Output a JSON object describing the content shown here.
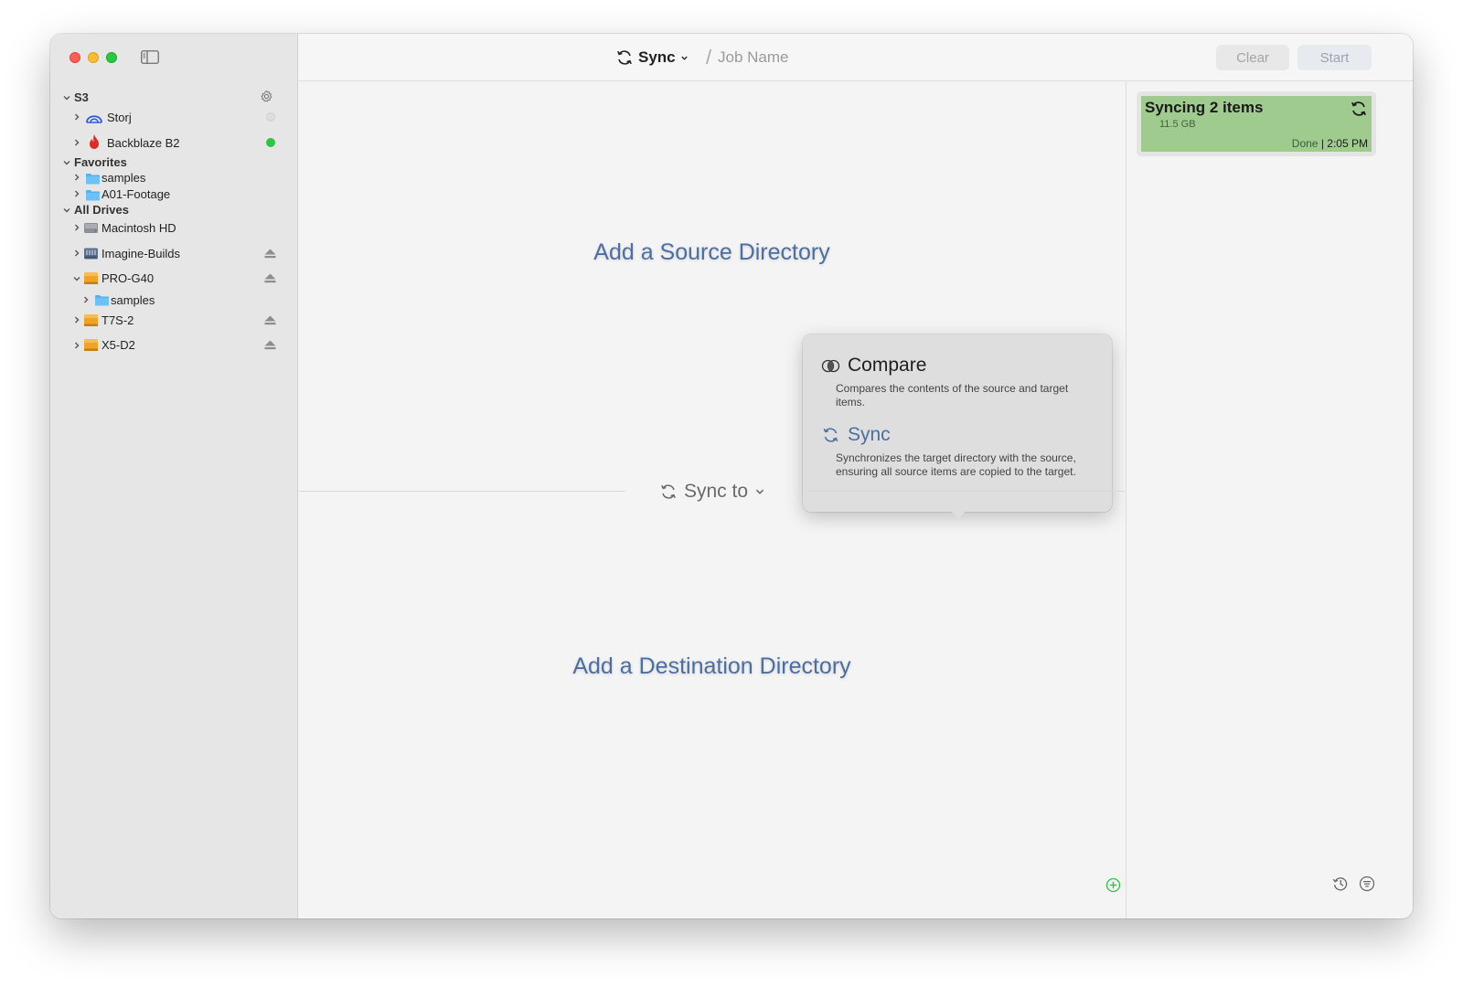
{
  "window": {
    "traffic_lights": [
      "close",
      "minimize",
      "zoom"
    ],
    "colors": {
      "close": "#fe5f57",
      "minimize": "#febc2e",
      "zoom": "#28c840",
      "accent": "#4b6ea3",
      "job_card": "#9fcb8f",
      "status_online": "#28c840"
    }
  },
  "sidebar": {
    "sections": [
      {
        "label": "S3",
        "items": [
          {
            "label": "Storj",
            "icon": "storj-icon",
            "status": "offline"
          },
          {
            "label": "Backblaze B2",
            "icon": "backblaze-flame-icon",
            "status": "online"
          }
        ]
      },
      {
        "label": "Favorites",
        "items": [
          {
            "label": "samples",
            "icon": "folder-icon"
          },
          {
            "label": "A01-Footage",
            "icon": "folder-icon"
          }
        ]
      },
      {
        "label": "All Drives",
        "items": [
          {
            "label": "Macintosh HD",
            "icon": "internal-drive-icon"
          },
          {
            "label": "Imagine-Builds",
            "icon": "network-drive-icon",
            "ejectable": true
          },
          {
            "label": "PRO-G40",
            "icon": "external-drive-icon",
            "ejectable": true,
            "expanded": true,
            "children": [
              {
                "label": "samples",
                "icon": "folder-icon"
              }
            ]
          },
          {
            "label": "T7S-2",
            "icon": "external-drive-icon",
            "ejectable": true
          },
          {
            "label": "X5-D2",
            "icon": "external-drive-icon",
            "ejectable": true
          }
        ]
      }
    ]
  },
  "toolbar": {
    "mode_label": "Sync",
    "separator": "/",
    "job_name_placeholder": "Job Name",
    "clear_label": "Clear",
    "start_label": "Start"
  },
  "main": {
    "add_source_label": "Add a Source Directory",
    "add_destination_label": "Add a Destination Directory",
    "sync_to_label": "Sync to"
  },
  "popover": {
    "items": [
      {
        "title": "Compare",
        "icon": "compare-icon",
        "description": "Compares the contents of the source and target items."
      },
      {
        "title": "Sync",
        "icon": "sync-icon",
        "description": "Synchronizes the target directory with the source, ensuring all source items are copied to the target."
      }
    ]
  },
  "jobs": [
    {
      "title": "Syncing 2 items",
      "size": "11.5 GB",
      "status": "Done",
      "time": "2:05 PM"
    }
  ]
}
